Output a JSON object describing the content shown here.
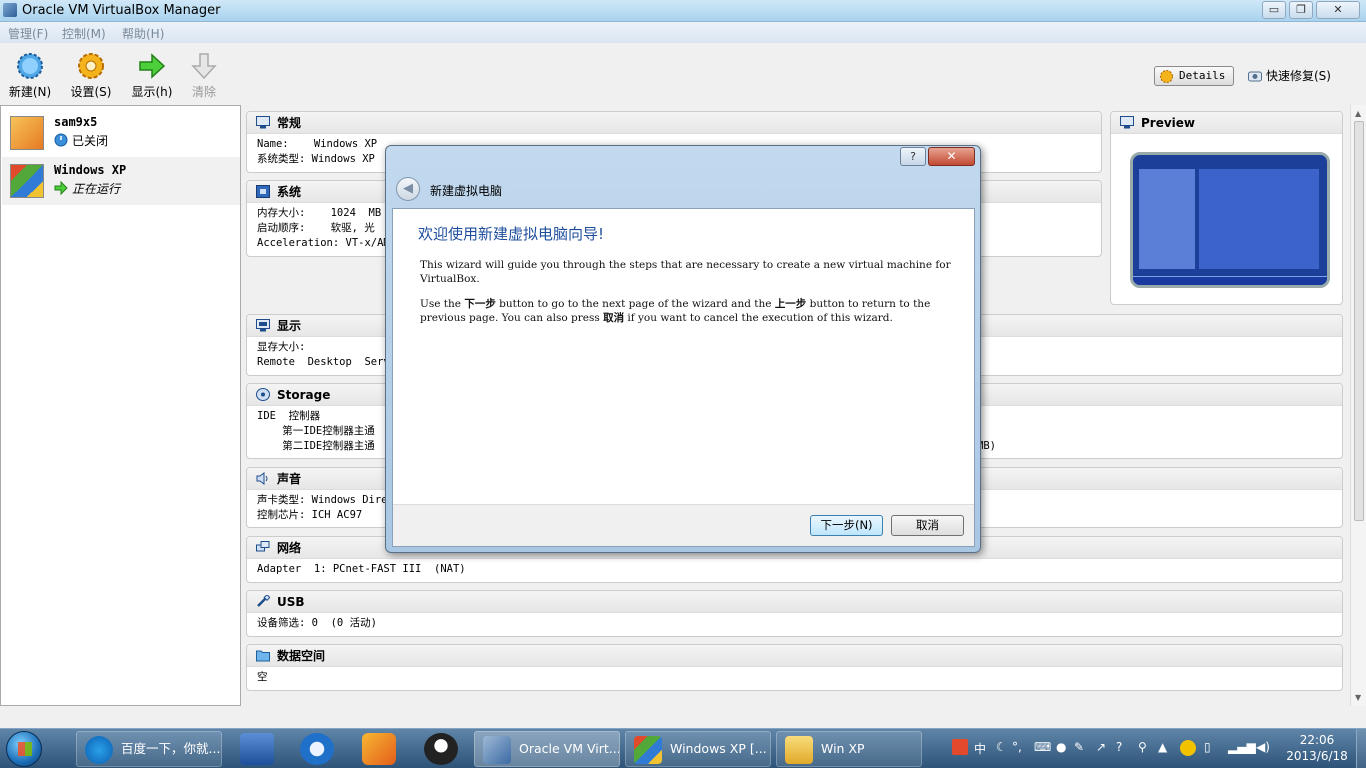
{
  "window": {
    "title": "Oracle VM VirtualBox Manager",
    "minimize_glyph": "▭",
    "maximize_glyph": "❐",
    "close_glyph": "✕"
  },
  "menubar": {
    "items": [
      "管理(F)",
      "控制(M)",
      "帮助(H)"
    ]
  },
  "toolbar": {
    "new_label": "新建(N)",
    "settings_label": "设置(S)",
    "show_label": "显示(h)",
    "discard_label": "清除",
    "details_label": "Details",
    "snapshots_label": "快速修复(S)"
  },
  "vm_list": [
    {
      "name": "sam9x5",
      "state": "已关闭"
    },
    {
      "name": "Windows XP",
      "state": "正在运行"
    }
  ],
  "details": {
    "general": {
      "title": "常规",
      "lines": [
        "Name:    Windows XP",
        "系统类型: Windows XP"
      ]
    },
    "system": {
      "title": "系统",
      "lines": [
        "内存大小:    1024  MB",
        "启动顺序:    软驱, 光",
        "Acceleration: VT-x/AMD"
      ]
    },
    "preview": {
      "title": "Preview"
    },
    "display": {
      "title": "显示",
      "lines": [
        "显存大小:",
        "Remote  Desktop  Serve"
      ]
    },
    "storage": {
      "title": "Storage",
      "lines": [
        "IDE  控制器",
        "    第一IDE控制器主通",
        "    第二IDE控制器主通"
      ],
      "trailing": "MB)"
    },
    "audio": {
      "title": "声音",
      "lines": [
        "声卡类型: Windows Dire",
        "控制芯片: ICH AC97"
      ]
    },
    "network": {
      "title": "网络",
      "lines": [
        "Adapter  1: PCnet-FAST III  (NAT)"
      ]
    },
    "usb": {
      "title": "USB",
      "lines": [
        "设备筛选: 0  (0 活动)"
      ]
    },
    "shared": {
      "title": "数据空间",
      "lines": [
        "空"
      ]
    }
  },
  "dialog": {
    "title": "新建虚拟电脑",
    "help_glyph": "?",
    "close_glyph": "✕",
    "heading": "欢迎使用新建虚拟电脑向导!",
    "para1": "This wizard will guide you through the steps that are necessary to create a new virtual machine for VirtualBox.",
    "para2_a": "Use the ",
    "para2_next": "下一步",
    "para2_b": " button to go to the next page of the wizard and the ",
    "para2_back": "上一步",
    "para2_c": " button to return to the previous page. You can also press ",
    "para2_cancel": "取消",
    "para2_d": " if you want to cancel the execution of this wizard.",
    "next_button": "下一步(N)",
    "cancel_button": "取消"
  },
  "taskbar": {
    "tasks": [
      {
        "label": "百度一下，你就..."
      },
      {
        "label": "Oracle VM Virt..."
      },
      {
        "label": "Windows XP [..."
      },
      {
        "label": "Win  XP"
      }
    ],
    "tray_ime": "中",
    "clock_time": "22:06",
    "clock_date": "2013/6/18"
  },
  "colors": {
    "accent_heading": "#1f4e9c",
    "taskbar": "#2d5478",
    "close_red": "#c14a32"
  }
}
